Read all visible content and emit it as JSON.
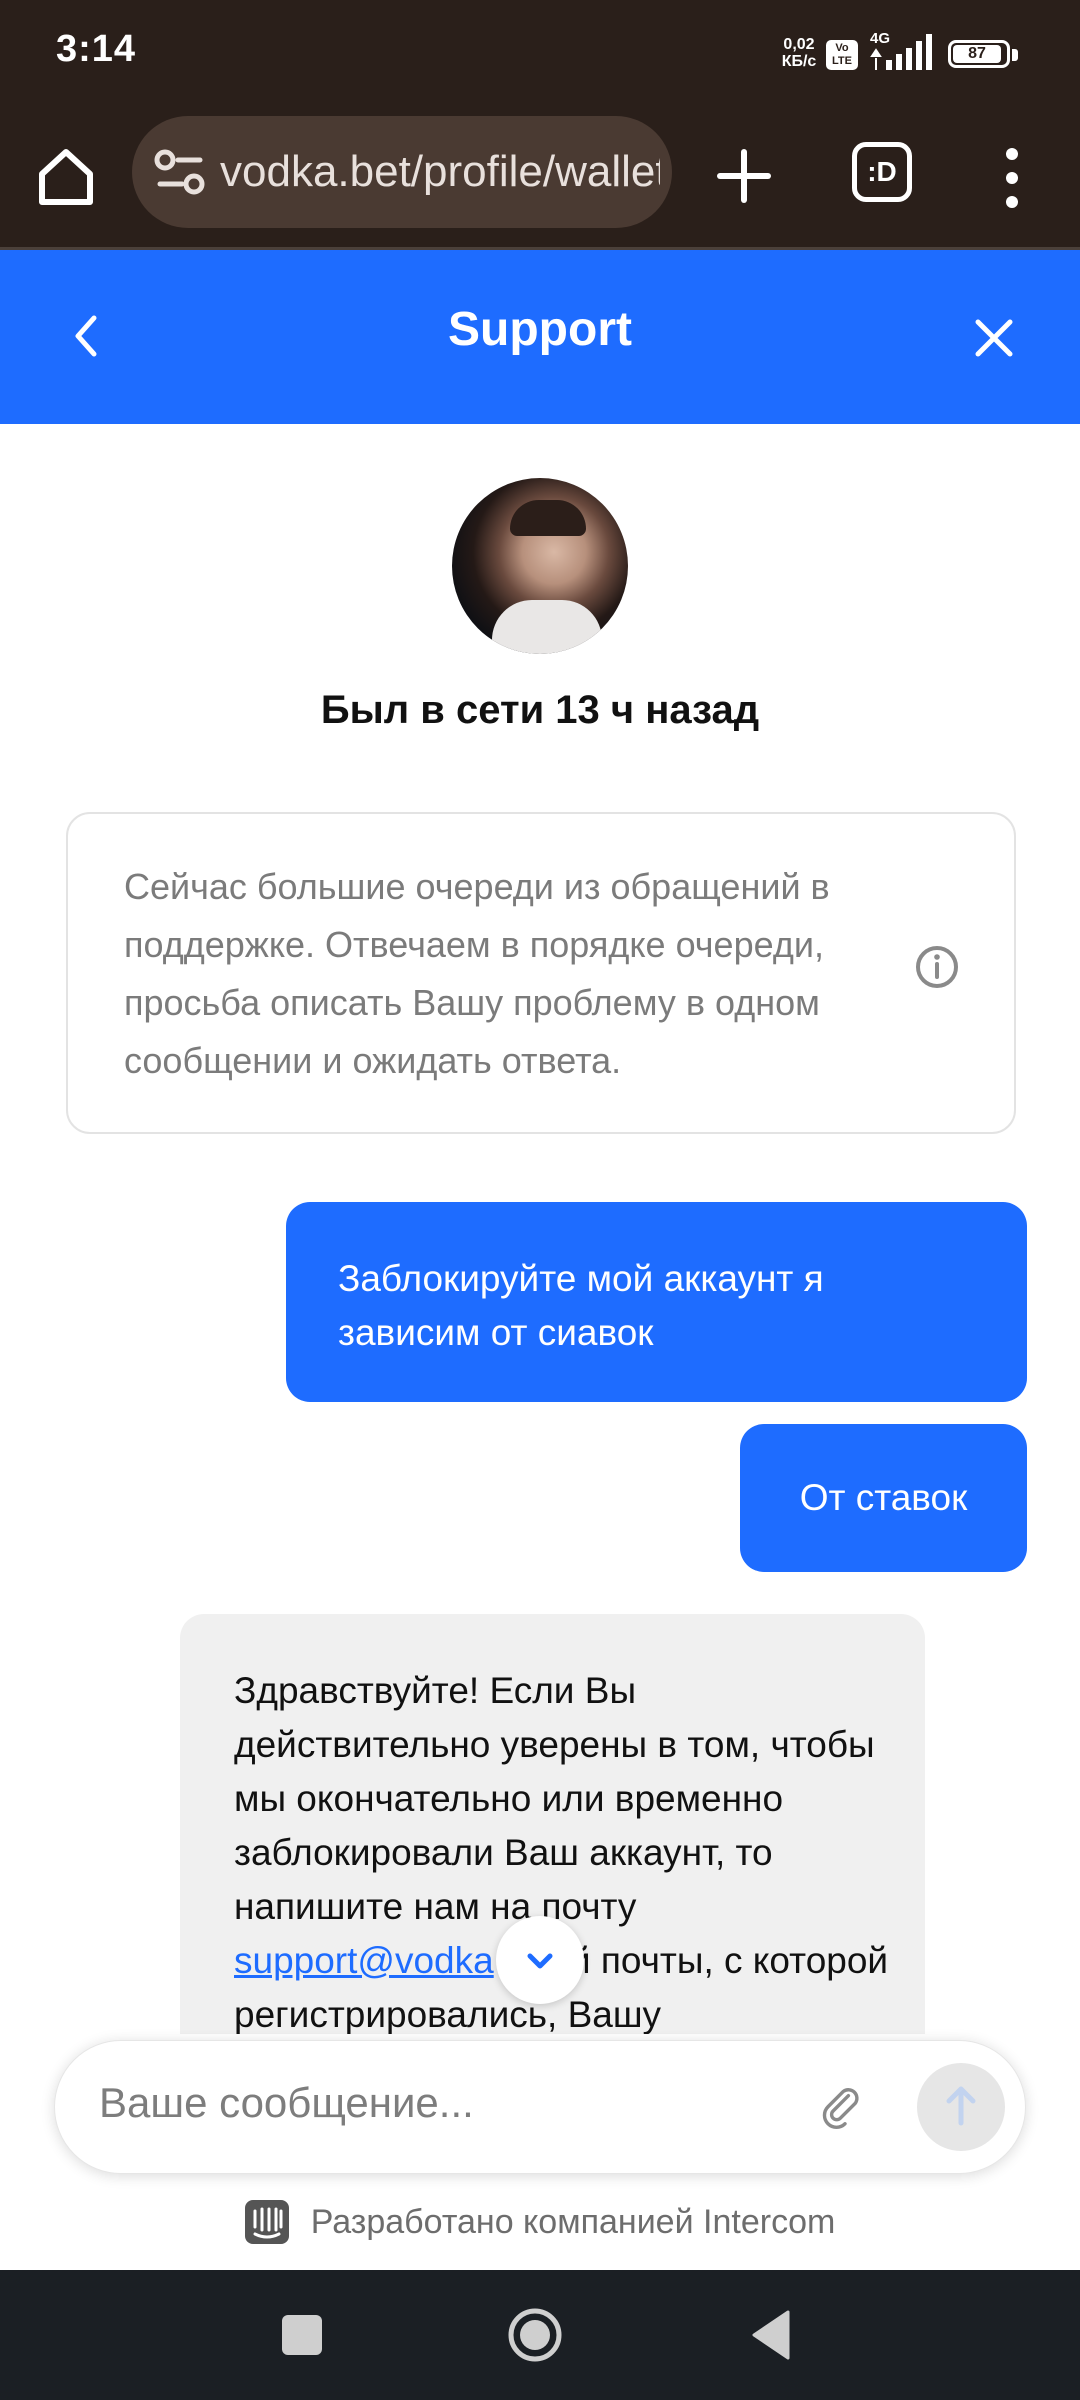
{
  "status_bar": {
    "time": "3:14",
    "net_speed_value": "0,02",
    "net_speed_unit": "КБ/с",
    "volte_top": "Vo",
    "volte_bottom": "LTE",
    "network": "4G",
    "battery": "87"
  },
  "browser": {
    "url": "vodka.bet/profile/wallet",
    "tabs_label": ":D"
  },
  "support": {
    "title": "Support",
    "agent_status": "Был в сети 13 ч назад"
  },
  "notice": {
    "text": "Сейчас большие очереди из обращений в поддержке. Отвечаем в порядке очереди, просьба описать Вашу проблему в одном сообщении и ожидать ответа."
  },
  "messages": {
    "user_1": "Заблокируйте мой аккаунт я зависим от сиавок",
    "user_2": "От ставок",
    "agent_1_before_link": "Здравствуйте! Если Вы действительно уверены в том, чтобы мы окончательно или временно заблокировали Ваш аккаунт, то напишите нам на почту ",
    "agent_1_link": "support@vodka",
    "agent_1_after_link": " с той почты, с которой регистрировались, Вашу"
  },
  "composer": {
    "placeholder": "Ваше сообщение..."
  },
  "footer": {
    "powered_by": "Разработано компанией Intercom"
  },
  "colors": {
    "accent": "#1e6cff",
    "browser_bg": "#2a1f1a",
    "agent_bubble": "#f0f0f0"
  }
}
